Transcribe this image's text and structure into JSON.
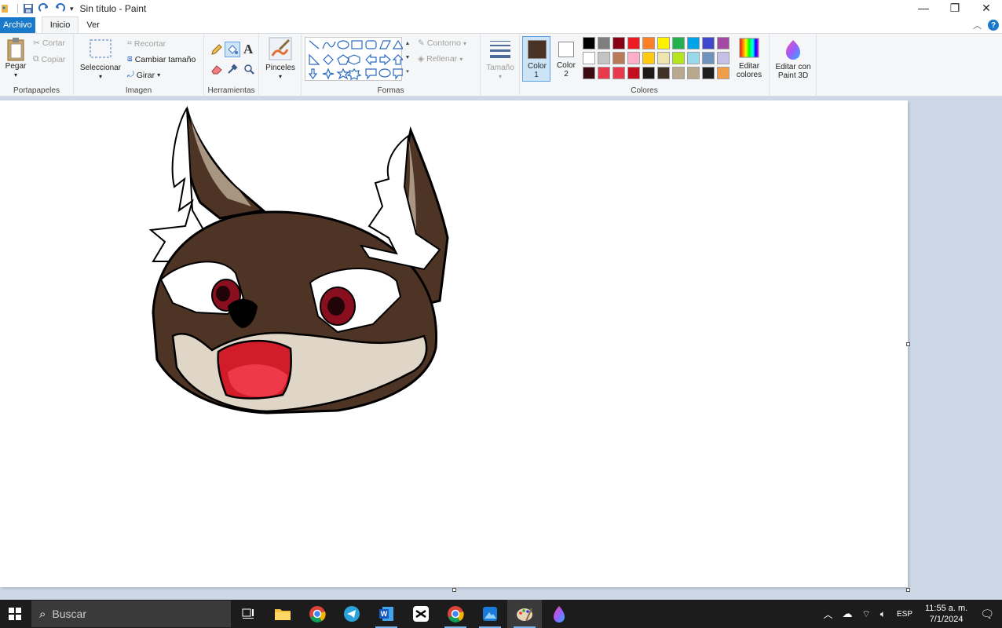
{
  "window": {
    "title": "Sin título - Paint",
    "minimize": "—",
    "restore": "❐",
    "close": "✕"
  },
  "tabs": {
    "file": "Archivo",
    "home": "Inicio",
    "view": "Ver"
  },
  "ribbon": {
    "clipboard": {
      "label": "Portapapeles",
      "paste": "Pegar",
      "cut": "Cortar",
      "copy": "Copiar"
    },
    "image": {
      "label": "Imagen",
      "select": "Seleccionar",
      "crop": "Recortar",
      "resize": "Cambiar tamaño",
      "rotate": "Girar"
    },
    "tools": {
      "label": "Herramientas"
    },
    "brushes": {
      "label": "Pinceles"
    },
    "shapes": {
      "label": "Formas",
      "outline": "Contorno",
      "fill": "Rellenar"
    },
    "size": {
      "label": "Tamaño"
    },
    "colors": {
      "label": "Colores",
      "color1": "Color 1",
      "color2": "Color 2",
      "edit_colors_1": "Editar",
      "edit_colors_2": "colores",
      "color1_value": "#4a3324",
      "color2_value": "#ffffff",
      "palette": [
        "#000000",
        "#7f7f7f",
        "#880015",
        "#ed1c24",
        "#ff7f27",
        "#fff200",
        "#22b14c",
        "#00a2e8",
        "#3f48cc",
        "#a349a4",
        "#ffffff",
        "#c3c3c3",
        "#b97a57",
        "#ffaec9",
        "#ffc90e",
        "#efe4b0",
        "#b5e61d",
        "#99d9ea",
        "#7092be",
        "#c8bfe7",
        "#3d0a12",
        "#e8394d",
        "#e8394d",
        "#c4101e",
        "#1d1a17",
        "#3f3328",
        "#b8a88e",
        "#b8a88e",
        "#202020",
        "#f29d49"
      ]
    },
    "paint3d": {
      "line1": "Editar con",
      "line2": "Paint 3D"
    }
  },
  "taskbar": {
    "search_placeholder": "Buscar",
    "language": "ESP",
    "time": "11:55 a. m.",
    "date": "7/1/2024"
  }
}
